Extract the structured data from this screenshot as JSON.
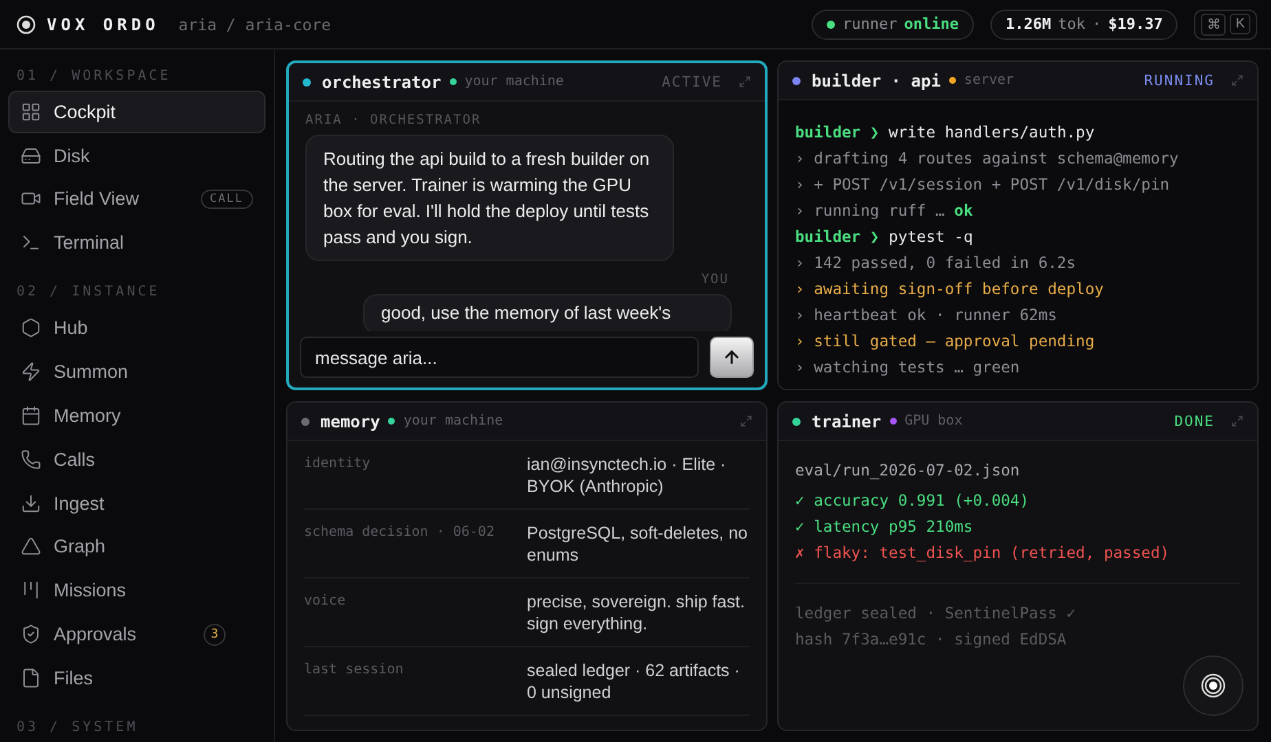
{
  "brand": {
    "name": "VOX ORDO",
    "path": "aria / aria-core"
  },
  "topbar": {
    "runner": {
      "label": "runner",
      "status": "online",
      "online": true
    },
    "usage": {
      "tokens": "1.26M",
      "unit": "tok",
      "sep": "·",
      "cost": "$19.37"
    },
    "shortcut": [
      "⌘",
      "K"
    ]
  },
  "sidebar": {
    "sections": [
      {
        "title": "01 / WORKSPACE",
        "items": [
          {
            "label": "Cockpit",
            "selected": true
          },
          {
            "label": "Disk",
            "selected": false
          },
          {
            "label": "Field View",
            "selected": false,
            "badge": "CALL"
          },
          {
            "label": "Terminal",
            "selected": false
          }
        ]
      },
      {
        "title": "02 / INSTANCE",
        "items": [
          {
            "label": "Hub",
            "selected": false
          },
          {
            "label": "Summon",
            "selected": false
          },
          {
            "label": "Memory",
            "selected": false
          },
          {
            "label": "Calls",
            "selected": false
          },
          {
            "label": "Ingest",
            "selected": false
          },
          {
            "label": "Graph",
            "selected": false
          },
          {
            "label": "Missions",
            "selected": false
          },
          {
            "label": "Approvals",
            "selected": false,
            "count": "3"
          },
          {
            "label": "Files",
            "selected": false
          }
        ]
      },
      {
        "title": "03 / SYSTEM"
      }
    ]
  },
  "panels": [
    {
      "kind": "chat",
      "title": "orchestrator",
      "color": "#22b8cf",
      "location": {
        "label": "your machine",
        "color": "#34d399"
      },
      "status": {
        "label": "ACTIVE",
        "color": "#55555d"
      },
      "selected": true,
      "messages": [
        {
          "kind": "agent",
          "author": "ARIA · ORCHESTRATOR",
          "text": "Routing the api build to a fresh builder on the server. Trainer is warming the GPU box for eval. I'll hold the deploy until tests pass and you sign."
        },
        {
          "kind": "user",
          "author": "YOU",
          "text": "good, use the memory of last week's"
        }
      ],
      "input": {
        "placeholder": "message aria..."
      }
    },
    {
      "kind": "terminal",
      "title": "builder · api",
      "color": "#7b83f0",
      "location": {
        "label": "server",
        "color": "#f5a524"
      },
      "status": {
        "label": "RUNNING",
        "color": "#7b8cf0"
      },
      "selected": false,
      "lines": [
        {
          "kind": "prompt",
          "prompt": "builder ❯",
          "text": "write handlers/auth.py"
        },
        {
          "kind": "out",
          "text": "› drafting 4 routes against schema@memory"
        },
        {
          "kind": "out",
          "text": "› + POST /v1/session + POST /v1/disk/pin"
        },
        {
          "kind": "out",
          "text": "› running ruff …",
          "tail": "ok"
        },
        {
          "kind": "prompt",
          "prompt": "builder ❯",
          "text": "pytest -q"
        },
        {
          "kind": "out",
          "text": "› 142 passed, 0 failed in 6.2s"
        },
        {
          "kind": "warn",
          "text": "› awaiting sign-off before deploy"
        },
        {
          "kind": "out",
          "text": "› heartbeat ok · runner 62ms"
        },
        {
          "kind": "warn",
          "text": "› still gated — approval pending"
        },
        {
          "kind": "out",
          "text": "› watching tests … green"
        }
      ]
    },
    {
      "kind": "memory",
      "title": "memory",
      "color": "#6b6b73",
      "location": {
        "label": "your machine",
        "color": "#34d399"
      },
      "selected": false,
      "rows": [
        {
          "key": "identity",
          "value": "ian@insynctech.io · Elite · BYOK (Anthropic)"
        },
        {
          "key": "schema decision · 06-02",
          "value": "PostgreSQL, soft-deletes, no enums"
        },
        {
          "key": "voice",
          "value": "precise, sovereign. ship fast. sign everything."
        },
        {
          "key": "last session",
          "value": "sealed ledger · 62 artifacts · 0 unsigned"
        }
      ]
    },
    {
      "kind": "report",
      "title": "trainer",
      "color": "#34d399",
      "location": {
        "label": "GPU box",
        "color": "#a855f7"
      },
      "status": {
        "label": "DONE",
        "color": "#4ade80"
      },
      "selected": false,
      "file": "eval/run_2026-07-02.json",
      "results": [
        {
          "kind": "pass",
          "text": "✓ accuracy 0.991 (+0.004)"
        },
        {
          "kind": "pass",
          "text": "✓ latency p95 210ms"
        },
        {
          "kind": "fail",
          "text": "✗ flaky: test_disk_pin (retried, passed)"
        }
      ],
      "footer": [
        "ledger sealed · SentinelPass ✓",
        "hash 7f3a…e91c · signed EdDSA"
      ]
    }
  ]
}
